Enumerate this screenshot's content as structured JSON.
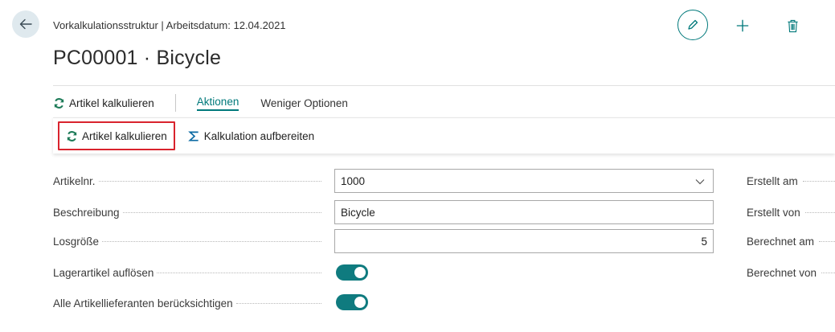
{
  "header": {
    "breadcrumb": "Vorkalkulationsstruktur | Arbeitsdatum: 12.04.2021",
    "title": "PC00001 · Bicycle"
  },
  "action_bar": {
    "calculate_label": "Artikel kalkulieren",
    "tab_actions": "Aktionen",
    "tab_fewer_options": "Weniger Optionen"
  },
  "sub_actions": {
    "calculate_item": "Artikel kalkulieren",
    "prepare_calculation": "Kalkulation aufbereiten"
  },
  "fields": {
    "item_no_label": "Artikelnr.",
    "item_no_value": "1000",
    "description_label": "Beschreibung",
    "description_value": "Bicycle",
    "lot_size_label": "Losgröße",
    "lot_size_value": "5",
    "explode_bom_label": "Lagerartikel auflösen",
    "explode_bom_value": true,
    "all_vendors_label": "Alle Artikellieferanten berücksichtigen",
    "all_vendors_value": true
  },
  "right_fields": {
    "created_on_label": "Erstellt am",
    "created_by_label": "Erstellt von",
    "calculated_on_label": "Berechnet am",
    "calculated_by_label": "Berechnet von"
  },
  "colors": {
    "accent": "#00797b",
    "highlight_border": "#d9232d",
    "toggle_on": "#0f7b7f"
  },
  "icons": {
    "back": "arrow-left-icon",
    "edit": "pencil-icon",
    "new": "plus-icon",
    "delete": "trash-icon",
    "refresh": "refresh-icon",
    "sum": "sigma-icon",
    "dropdown": "chevron-down-icon"
  }
}
